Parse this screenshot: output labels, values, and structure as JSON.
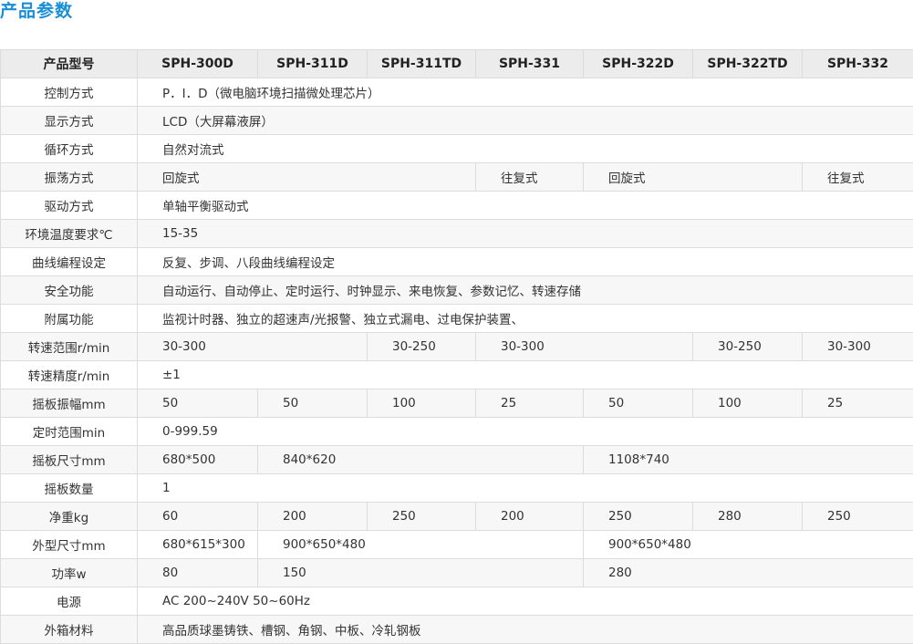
{
  "page": {
    "title": "产品参数"
  },
  "table": {
    "header": {
      "param_label": "产品型号",
      "models": [
        "SPH-300D",
        "SPH-311D",
        "SPH-311TD",
        "SPH-331",
        "SPH-322D",
        "SPH-322TD",
        "SPH-332"
      ]
    },
    "rows": {
      "control": {
        "label": "控制方式",
        "value": "P．I．D（微电脑环境扫描微处理芯片）"
      },
      "display": {
        "label": "显示方式",
        "value": "LCD（大屏幕液屏）"
      },
      "circ": {
        "label": "循环方式",
        "value": "自然对流式"
      },
      "osc": {
        "label": "振荡方式",
        "v1": "回旋式",
        "v2": "往复式",
        "v3": "回旋式",
        "v4": "往复式"
      },
      "drive": {
        "label": "驱动方式",
        "value": "单轴平衡驱动式"
      },
      "envtemp": {
        "label": "环境温度要求℃",
        "value": "15-35"
      },
      "curve": {
        "label": "曲线编程设定",
        "value": "反复、步调、八段曲线编程设定"
      },
      "safety": {
        "label": "安全功能",
        "value": "自动运行、自动停止、定时运行、时钟显示、来电恢复、参数记忆、转速存储"
      },
      "aux": {
        "label": "附属功能",
        "value": "监视计时器、独立的超速声/光报警、独立式漏电、过电保护装置、"
      },
      "speed": {
        "label": "转速范围r/min",
        "v1": "30-300",
        "v2": "30-250",
        "v3": "30-300",
        "v4": "30-250",
        "v5": "30-300"
      },
      "precision": {
        "label": "转速精度r/min",
        "value": "±1"
      },
      "amp": {
        "label": "摇板振幅mm",
        "values": [
          "50",
          "50",
          "100",
          "25",
          "50",
          "100",
          "25"
        ]
      },
      "timer": {
        "label": "定时范围min",
        "value": "0-999.59"
      },
      "size": {
        "label": "摇板尺寸mm",
        "v1": "680*500",
        "v2": "840*620",
        "v3": "1108*740"
      },
      "count": {
        "label": "摇板数量",
        "value": "1"
      },
      "weight": {
        "label": "净重kg",
        "values": [
          "60",
          "200",
          "250",
          "200",
          "250",
          "280",
          "250"
        ]
      },
      "outer": {
        "label": "外型尺寸mm",
        "v1": "680*615*300",
        "v2": "900*650*480",
        "v3": "900*650*480"
      },
      "power": {
        "label": "功率w",
        "v1": "80",
        "v2": "150",
        "v3": "280"
      },
      "supply": {
        "label": "电源",
        "value": "AC 200~240V 50~60Hz"
      },
      "material": {
        "label": "外箱材料",
        "value": "高品质球墨铸铁、槽钢、角钢、中板、冷轧钢板"
      }
    }
  }
}
